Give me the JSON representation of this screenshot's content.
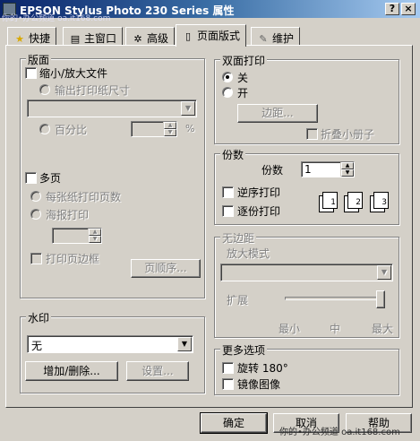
{
  "window": {
    "title": "EPSON Stylus Photo 230 Series 属性",
    "watermark": "你的•办公频道 oa.it168.com",
    "help_label": "?",
    "close_label": "×"
  },
  "tabs": [
    {
      "label": "快捷",
      "icon": "star-icon"
    },
    {
      "label": "主窗口",
      "icon": "printer-icon"
    },
    {
      "label": "高级",
      "icon": "gear-icon"
    },
    {
      "label": "页面版式",
      "icon": "page-icon",
      "active": true
    },
    {
      "label": "维护",
      "icon": "brush-icon"
    }
  ],
  "layout_group": {
    "title": "版面",
    "scale_label": "缩小/放大文件",
    "output_size_label": "输出打印纸尺寸",
    "percent_label": "百分比",
    "percent_unit": "%",
    "multipage_label": "多页",
    "pages_per_sheet_label": "每张纸打印页数",
    "poster_label": "海报打印",
    "print_border_label": "打印页边框",
    "page_order_button": "页顺序..."
  },
  "duplex_group": {
    "title": "双面打印",
    "off_label": "关",
    "on_label": "开",
    "margin_button": "边距...",
    "fold_booklet_label": "折叠小册子"
  },
  "copies_group": {
    "title": "份数",
    "copies_label": "份数",
    "copies_value": "1",
    "reverse_label": "逆序打印",
    "collate_label": "逐份打印",
    "page_icons": [
      "1",
      "2",
      "3"
    ]
  },
  "borderless_group": {
    "title": "无边距",
    "enlarge_mode_label": "放大模式",
    "expand_label": "扩展",
    "slider_value_fraction": 1.0,
    "tick_labels": [
      "最小",
      "中",
      "最大"
    ]
  },
  "watermark_group": {
    "title": "水印",
    "selected": "无",
    "add_delete_button": "增加/删除...",
    "settings_button": "设置..."
  },
  "more_options_group": {
    "title": "更多选项",
    "rotate_label": "旋转 180°",
    "mirror_label": "镜像图像"
  },
  "footer": {
    "ok_button": "确定",
    "cancel_button": "取消",
    "help_button": "帮助",
    "watermark": "你的•办公频道 oa.it168.com"
  },
  "colors": {
    "face": "#d4d0c8",
    "titlebar_start": "#0a246a",
    "titlebar_end": "#a6caf0"
  }
}
